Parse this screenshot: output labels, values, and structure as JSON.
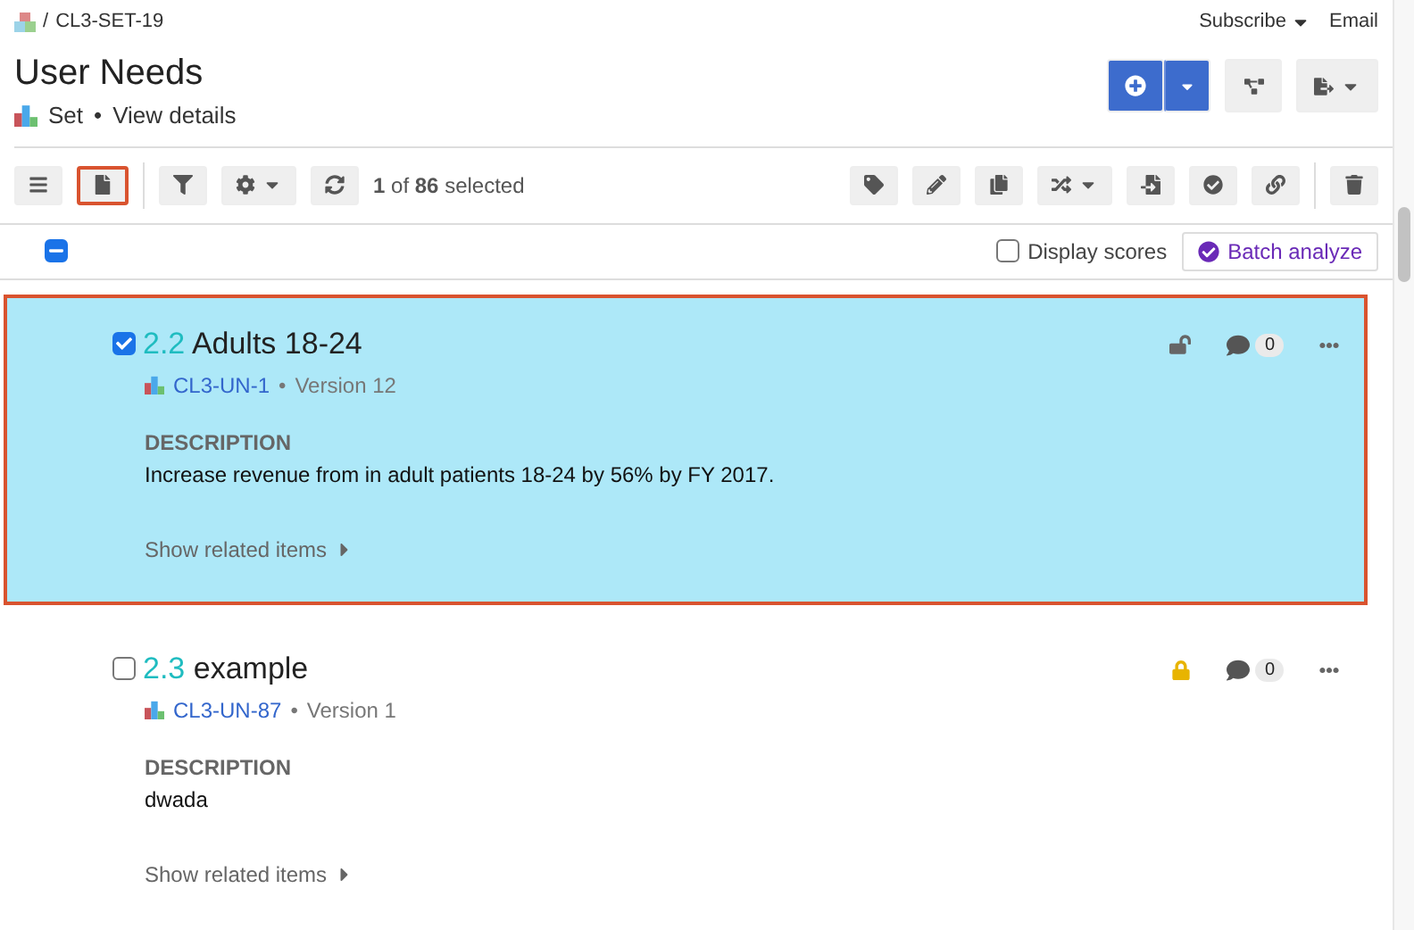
{
  "breadcrumb": {
    "separator": "/",
    "current": "CL3-SET-19"
  },
  "header_links": [
    {
      "label": "Subscribe",
      "dropdown": true
    },
    {
      "label": "Email",
      "dropdown": false
    }
  ],
  "title": "User Needs",
  "subtitle": {
    "type": "Set",
    "separator": "•",
    "link": "View details"
  },
  "view_modes": [
    {
      "kind": "list",
      "selected": false
    },
    {
      "kind": "document",
      "selected": true
    }
  ],
  "selection_count": "**1** of **86** selected",
  "select_all": {
    "indeterminate": true
  },
  "display_scores": {
    "label": "Display scores",
    "checked": false
  },
  "batch_analyze": "Batch analyze",
  "items": [
    {
      "number": "2.2",
      "title": "Adults 18-24",
      "id": "CL3-UN-1",
      "separator": "•",
      "version": "Version 12",
      "checked": true,
      "locked": false,
      "comments": "0",
      "description_label": "DESCRIPTION",
      "description": "Increase revenue from in adult patients 18-24 by 56% by FY 2017.",
      "related": "Show related items"
    },
    {
      "number": "2.3",
      "title": "example",
      "id": "CL3-UN-87",
      "separator": "•",
      "version": "Version 1",
      "checked": false,
      "locked": true,
      "comments": "0",
      "description_label": "DESCRIPTION",
      "description": "dwada",
      "related": "Show related items"
    }
  ]
}
